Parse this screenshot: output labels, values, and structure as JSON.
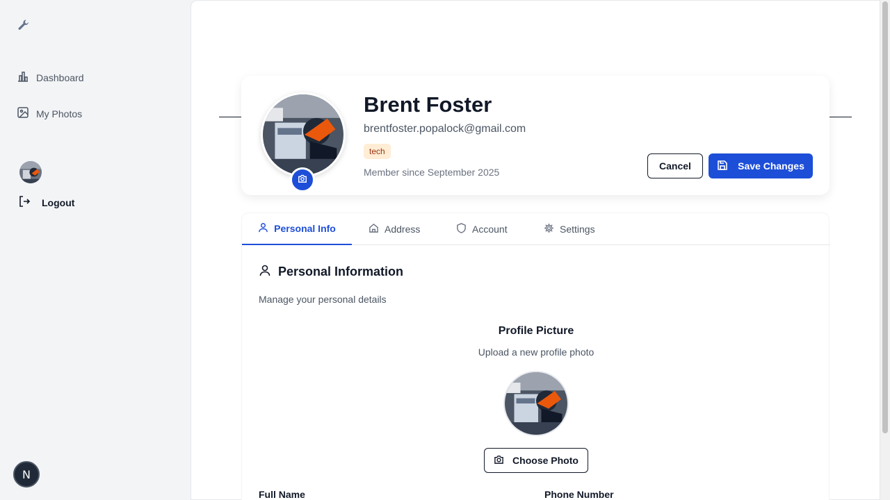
{
  "sidebar": {
    "logo_icon": "wrench-icon",
    "items": [
      {
        "label": "Dashboard",
        "icon": "bar-chart-icon"
      },
      {
        "label": "My Photos",
        "icon": "image-icon"
      }
    ],
    "logout_label": "Logout",
    "n_badge": "N"
  },
  "profile": {
    "name": "Brent Foster",
    "email": "brentfoster.popalock@gmail.com",
    "role": "tech",
    "member_since": "Member since September 2025",
    "cancel_label": "Cancel",
    "save_label": "Save Changes"
  },
  "tabs": [
    {
      "label": "Personal Info",
      "icon": "user-icon",
      "active": true
    },
    {
      "label": "Address",
      "icon": "home-icon",
      "active": false
    },
    {
      "label": "Account",
      "icon": "shield-icon",
      "active": false
    },
    {
      "label": "Settings",
      "icon": "gear-icon",
      "active": false
    }
  ],
  "personal": {
    "title": "Personal Information",
    "subtitle": "Manage your personal details",
    "picture_title": "Profile Picture",
    "picture_subtitle": "Upload a new profile photo",
    "choose_photo_label": "Choose Photo",
    "full_name_label": "Full Name",
    "phone_label": "Phone Number"
  },
  "colors": {
    "accent": "#1d4ed8",
    "badge_bg": "#ffedd5",
    "badge_text": "#9a3412"
  }
}
